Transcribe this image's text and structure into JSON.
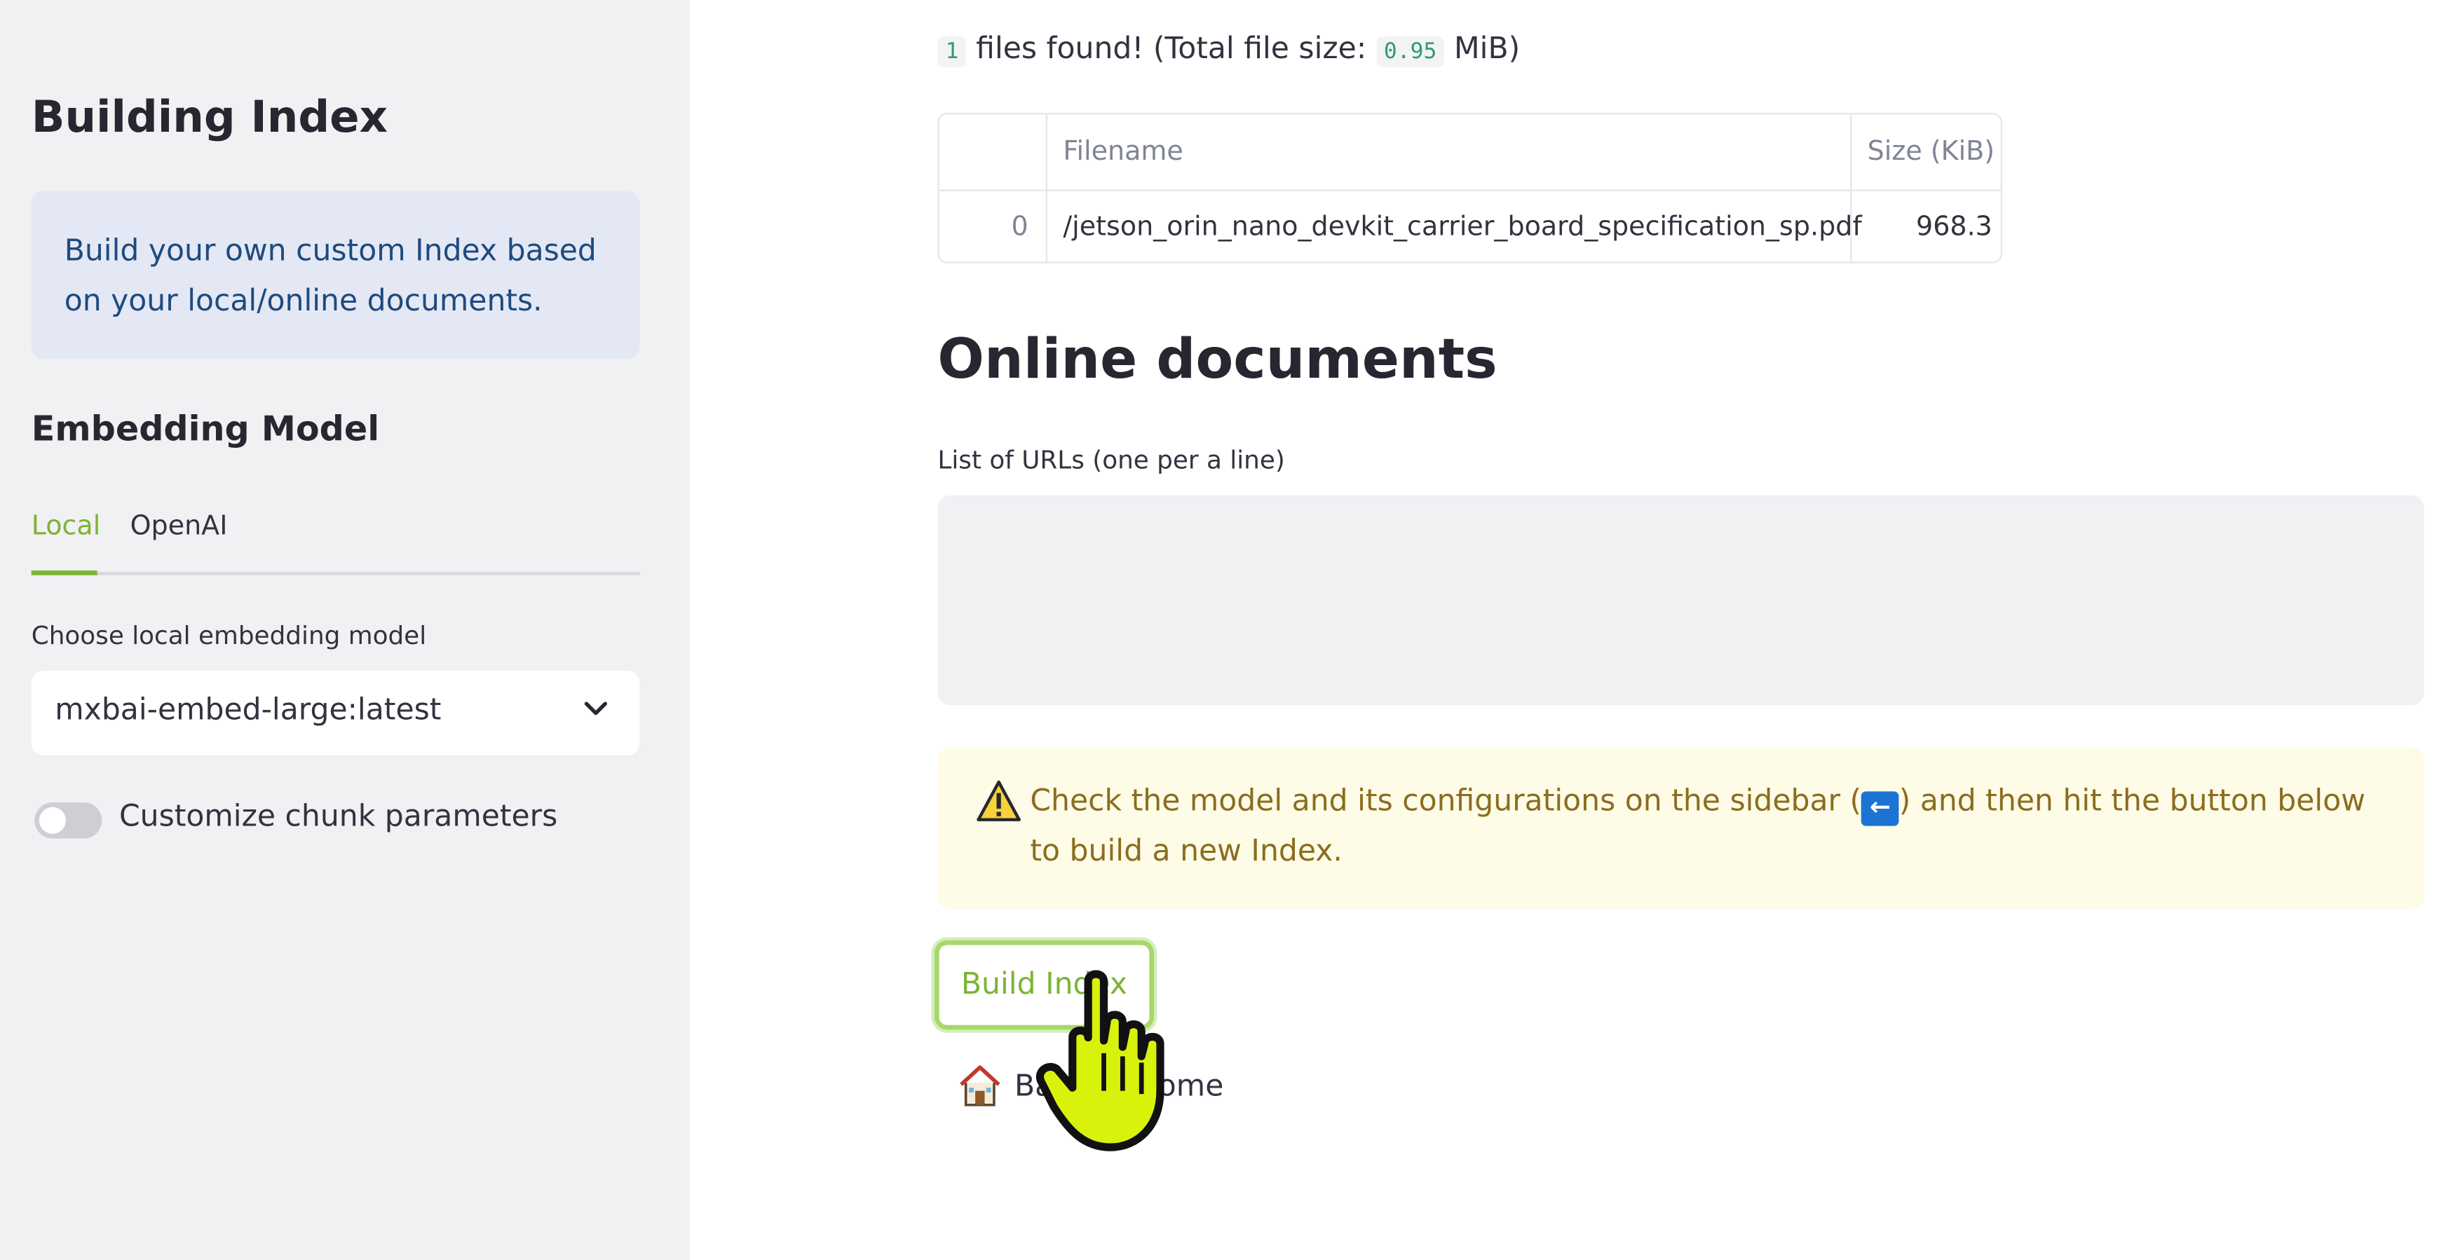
{
  "sidebar": {
    "title": "Building Index",
    "info": "Build your own custom Index based on your local/online documents.",
    "embedding_heading": "Embedding Model",
    "tabs": [
      {
        "label": "Local",
        "active": true
      },
      {
        "label": "OpenAI",
        "active": false
      }
    ],
    "model_label": "Choose local embedding model",
    "model_value": "mxbai-embed-large:latest",
    "chunk_toggle_label": "Customize chunk parameters",
    "chunk_toggle_on": false
  },
  "main": {
    "files_count": "1",
    "files_found_text": "files found! (Total file size:",
    "total_size": "0.95",
    "size_unit": "MiB)",
    "table": {
      "columns": [
        "",
        "Filename",
        "Size (KiB)"
      ],
      "rows": [
        {
          "index": "0",
          "filename": "/jetson_orin_nano_devkit_carrier_board_specification_sp.pdf",
          "size": "968.3"
        }
      ]
    },
    "online_heading": "Online documents",
    "urls_label": "List of URLs (one per a line)",
    "urls_value": "",
    "warning_before": "Check the model and its configurations on the sidebar (",
    "warning_arrow": "←",
    "warning_after": ") and then hit the button below to build a new Index.",
    "build_button": "Build Index",
    "back_link": "Back to Home"
  },
  "colors": {
    "accent": "#7ab532",
    "sidebar_bg": "#f1f0f3",
    "info_bg": "#e3e8f4",
    "warning_bg": "#fefbe6",
    "warning_text": "#8a6d1f"
  }
}
